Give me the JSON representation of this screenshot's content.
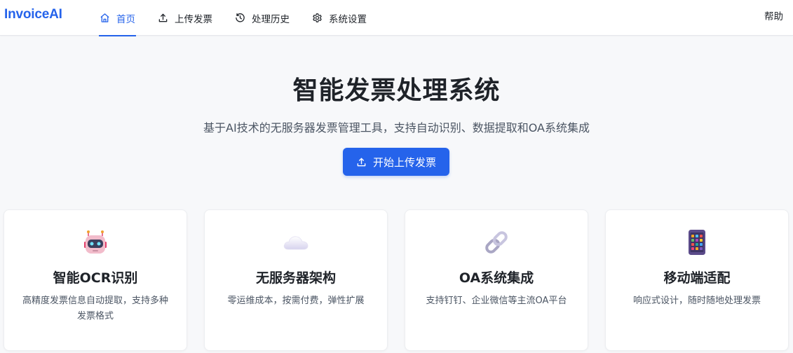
{
  "header": {
    "logo": "InvoiceAI",
    "nav": [
      {
        "label": "首页",
        "icon": "home-icon",
        "active": true
      },
      {
        "label": "上传发票",
        "icon": "upload-icon",
        "active": false
      },
      {
        "label": "处理历史",
        "icon": "history-icon",
        "active": false
      },
      {
        "label": "系统设置",
        "icon": "gear-icon",
        "active": false
      }
    ],
    "help": "帮助"
  },
  "hero": {
    "title": "智能发票处理系统",
    "subtitle": "基于AI技术的无服务器发票管理工具，支持自动识别、数据提取和OA系统集成",
    "cta_label": "开始上传发票",
    "cta_icon": "upload-icon"
  },
  "features": [
    {
      "icon": "robot-icon",
      "title": "智能OCR识别",
      "desc": "高精度发票信息自动提取，支持多种发票格式"
    },
    {
      "icon": "cloud-icon",
      "title": "无服务器架构",
      "desc": "零运维成本，按需付费，弹性扩展"
    },
    {
      "icon": "link-icon",
      "title": "OA系统集成",
      "desc": "支持钉钉、企业微信等主流OA平台"
    },
    {
      "icon": "mobile-icon",
      "title": "移动端适配",
      "desc": "响应式设计，随时随地处理发票"
    }
  ],
  "colors": {
    "accent": "#2563eb",
    "background": "#f7f8fa",
    "text": "#1f2329",
    "muted": "#4b5563"
  }
}
